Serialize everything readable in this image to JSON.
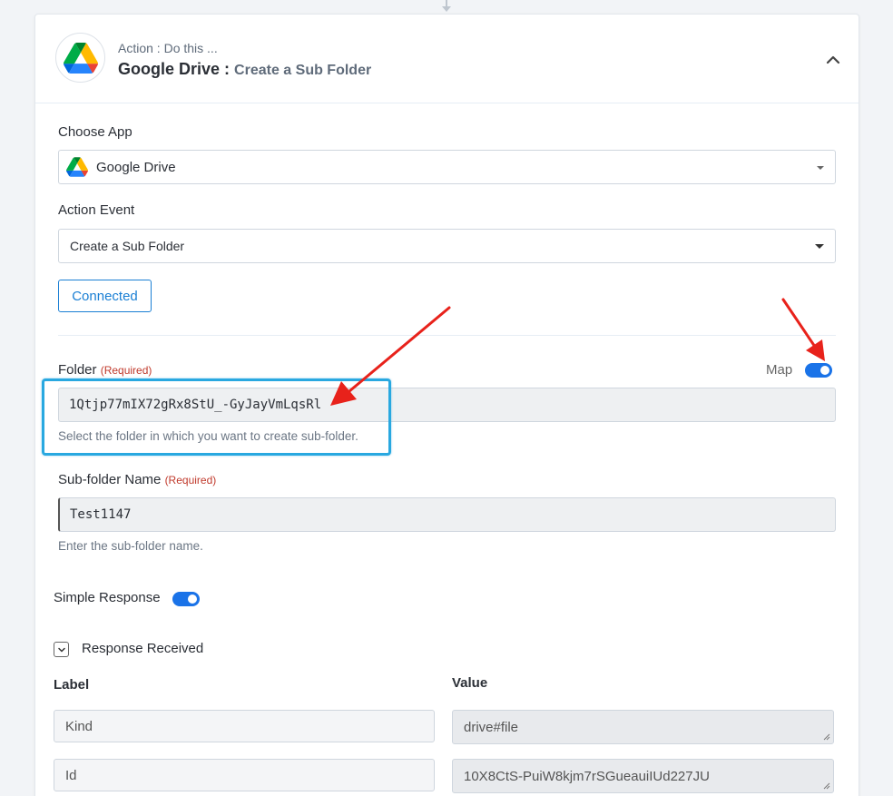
{
  "header": {
    "subtitle": "Action : Do this ...",
    "app_name": "Google Drive :",
    "event_name": "Create a Sub Folder"
  },
  "choose_app": {
    "label": "Choose App",
    "value": "Google Drive"
  },
  "action_event": {
    "label": "Action Event",
    "value": "Create a Sub Folder"
  },
  "connected_button": "Connected",
  "folder": {
    "label": "Folder",
    "required": "(Required)",
    "map_label": "Map",
    "map_enabled": true,
    "value": "1Qtjp77mIX72gRx8StU_-GyJayVmLqsRl",
    "help": "Select the folder in which you want to create sub-folder."
  },
  "subfolder": {
    "label": "Sub-folder Name",
    "required": "(Required)",
    "value": "Test1147",
    "help": "Enter the sub-folder name."
  },
  "simple_response": {
    "label": "Simple Response",
    "enabled": true
  },
  "response_received": {
    "label": "Response Received",
    "col_label": "Label",
    "col_value": "Value",
    "rows": [
      {
        "label": "Kind",
        "value": "drive#file"
      },
      {
        "label": "Id",
        "value": "10X8CtS-PuiW8kjm7rSGueauiIUd227JU"
      }
    ]
  },
  "colors": {
    "accent": "#1a73e8",
    "highlight": "#29a8e0",
    "annotation_arrow": "#e8221b",
    "required": "#c0392b"
  }
}
